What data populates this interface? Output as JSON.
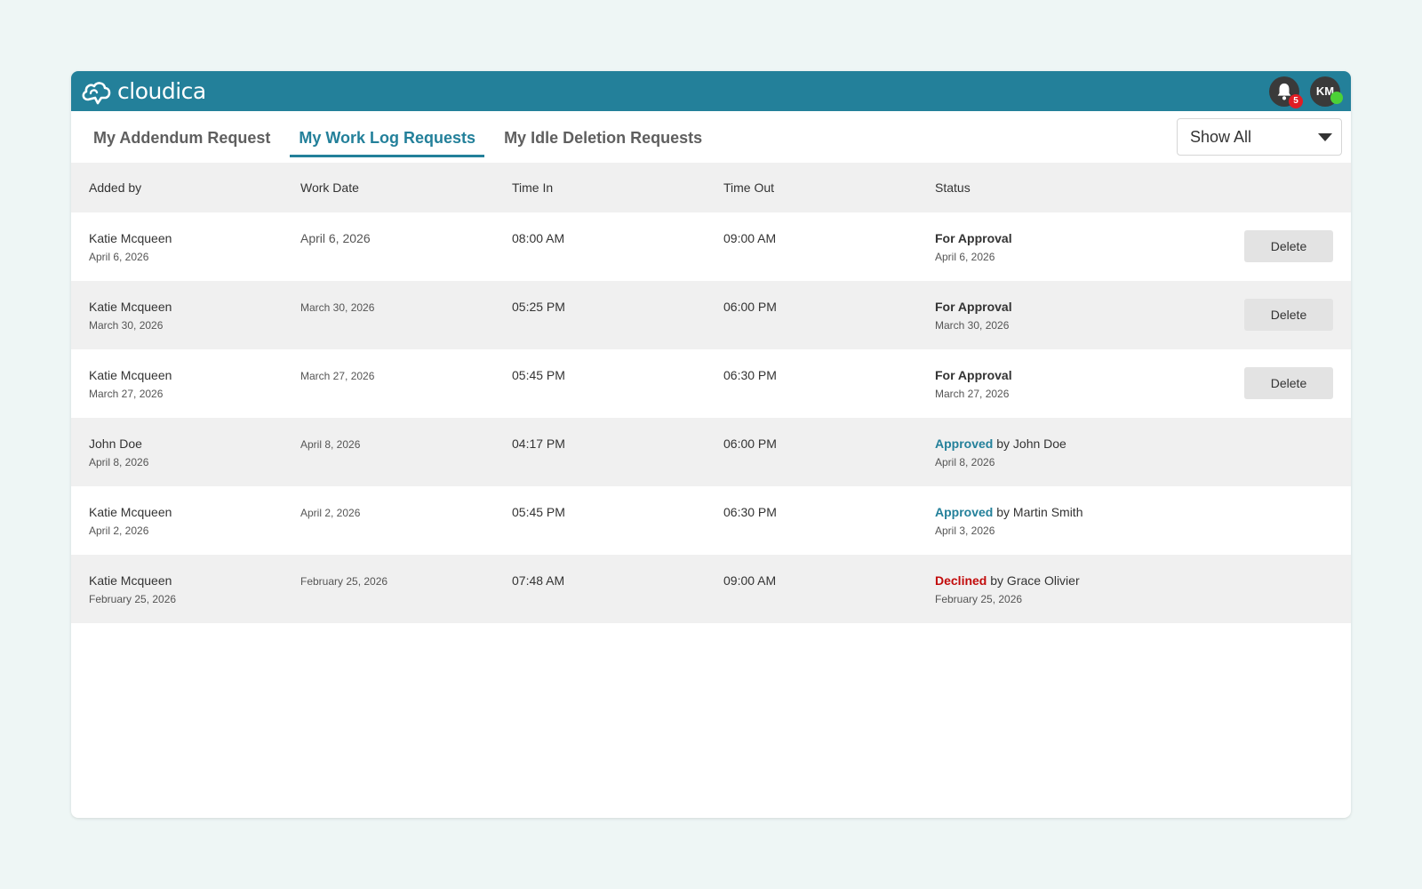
{
  "brand": {
    "name": "cloudica",
    "logo_icon": "cloud-icon"
  },
  "header": {
    "notifications_count": "5",
    "avatar_initials": "KM"
  },
  "tabs": [
    {
      "label": "My Addendum Request",
      "active": false
    },
    {
      "label": "My Work Log Requests",
      "active": true
    },
    {
      "label": "My Idle Deletion Requests",
      "active": false
    }
  ],
  "filter": {
    "selected": "Show All"
  },
  "table": {
    "columns": [
      "Added by",
      "Work Date",
      "Time In",
      "Time Out",
      "Status"
    ],
    "rows": [
      {
        "added_by": "Katie Mcqueen",
        "added_date": "April 6, 2026",
        "work_date": "April 6, 2026",
        "time_in": "08:00 AM",
        "time_out": "09:00 AM",
        "status": "For Approval",
        "status_by": "",
        "status_date": "April 6, 2026",
        "action": "Delete"
      },
      {
        "added_by": "Katie Mcqueen",
        "added_date": "March 30, 2026",
        "work_date": "March 30, 2026",
        "time_in": "05:25 PM",
        "time_out": "06:00 PM",
        "status": "For Approval",
        "status_by": "",
        "status_date": "March 30, 2026",
        "action": "Delete"
      },
      {
        "added_by": "Katie Mcqueen",
        "added_date": "March 27, 2026",
        "work_date": "March 27, 2026",
        "time_in": "05:45 PM",
        "time_out": "06:30 PM",
        "status": "For Approval",
        "status_by": "",
        "status_date": "March 27, 2026",
        "action": "Delete"
      },
      {
        "added_by": "John Doe",
        "added_date": "April 8, 2026",
        "work_date": "April 8, 2026",
        "time_in": "04:17 PM",
        "time_out": "06:00 PM",
        "status": "Approved",
        "status_by": "by John Doe",
        "status_date": "April 8, 2026",
        "action": ""
      },
      {
        "added_by": "Katie Mcqueen",
        "added_date": "April 2, 2026",
        "work_date": "April 2, 2026",
        "time_in": "05:45 PM",
        "time_out": "06:30 PM",
        "status": "Approved",
        "status_by": "by Martin Smith",
        "status_date": "April 3, 2026",
        "action": ""
      },
      {
        "added_by": "Katie Mcqueen",
        "added_date": "February 25, 2026",
        "work_date": "February 25, 2026",
        "time_in": "07:48 AM",
        "time_out": "09:00 AM",
        "status": "Declined",
        "status_by": "by Grace Olivier",
        "status_date": "February 25, 2026",
        "action": ""
      }
    ]
  },
  "colors": {
    "brand": "#23809a",
    "approved": "#23809a",
    "declined": "#c20b0b",
    "badge": "#e11d24",
    "presence": "#4cd137"
  }
}
